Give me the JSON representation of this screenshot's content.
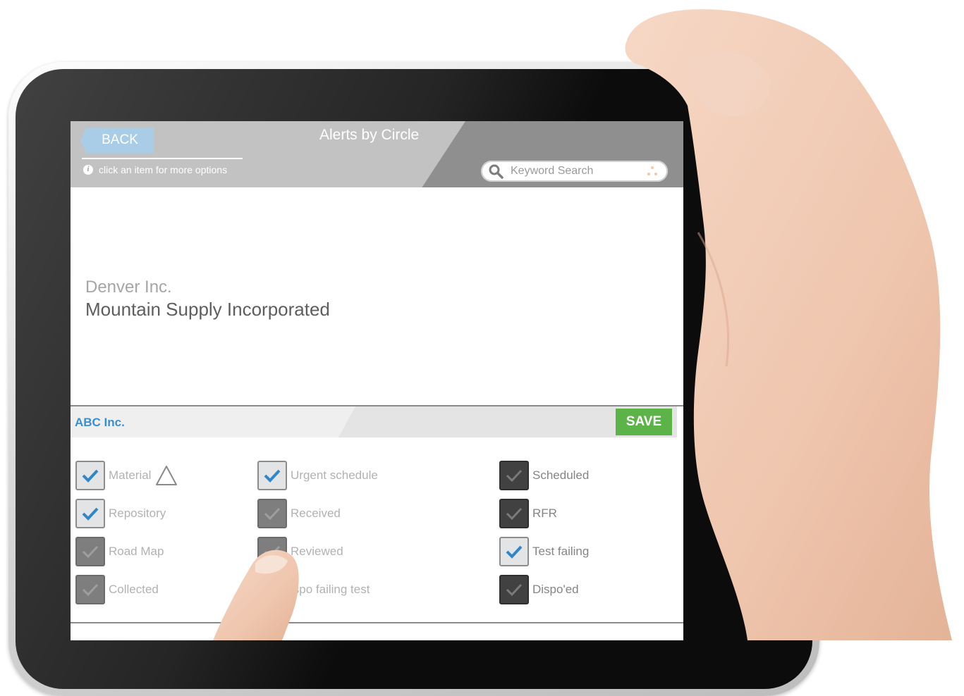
{
  "header": {
    "back_label": "BACK",
    "title": "Alerts by Circle",
    "hint": "click an item for more options",
    "search_placeholder": "Keyword Search"
  },
  "company": {
    "sub_name": "Denver Inc.",
    "main_name": "Mountain Supply Incorporated"
  },
  "panel": {
    "name": "ABC Inc.",
    "save_label": "SAVE",
    "options": [
      {
        "label": "Material",
        "state": "checked",
        "icon": "warning-triangle-icon"
      },
      {
        "label": "Repository",
        "state": "checked"
      },
      {
        "label": "Road Map",
        "state": "dim-checked"
      },
      {
        "label": "Collected",
        "state": "dim-checked"
      },
      {
        "label": "Urgent schedule",
        "state": "checked"
      },
      {
        "label": "Received",
        "state": "dim-checked"
      },
      {
        "label": "Reviewed",
        "state": "dim-checked"
      },
      {
        "label": "ispo failing test",
        "state": "dim-checked"
      },
      {
        "label": "Scheduled",
        "state": "dark-checked"
      },
      {
        "label": "RFR",
        "state": "dark-checked"
      },
      {
        "label": "Test failing",
        "state": "checked"
      },
      {
        "label": "Dispo'ed",
        "state": "dark-checked"
      }
    ]
  },
  "colors": {
    "accent_blue": "#3a8fd0",
    "save_green": "#5cb348",
    "back_blue": "#a9cde6",
    "check_blue": "#2f86c8"
  }
}
